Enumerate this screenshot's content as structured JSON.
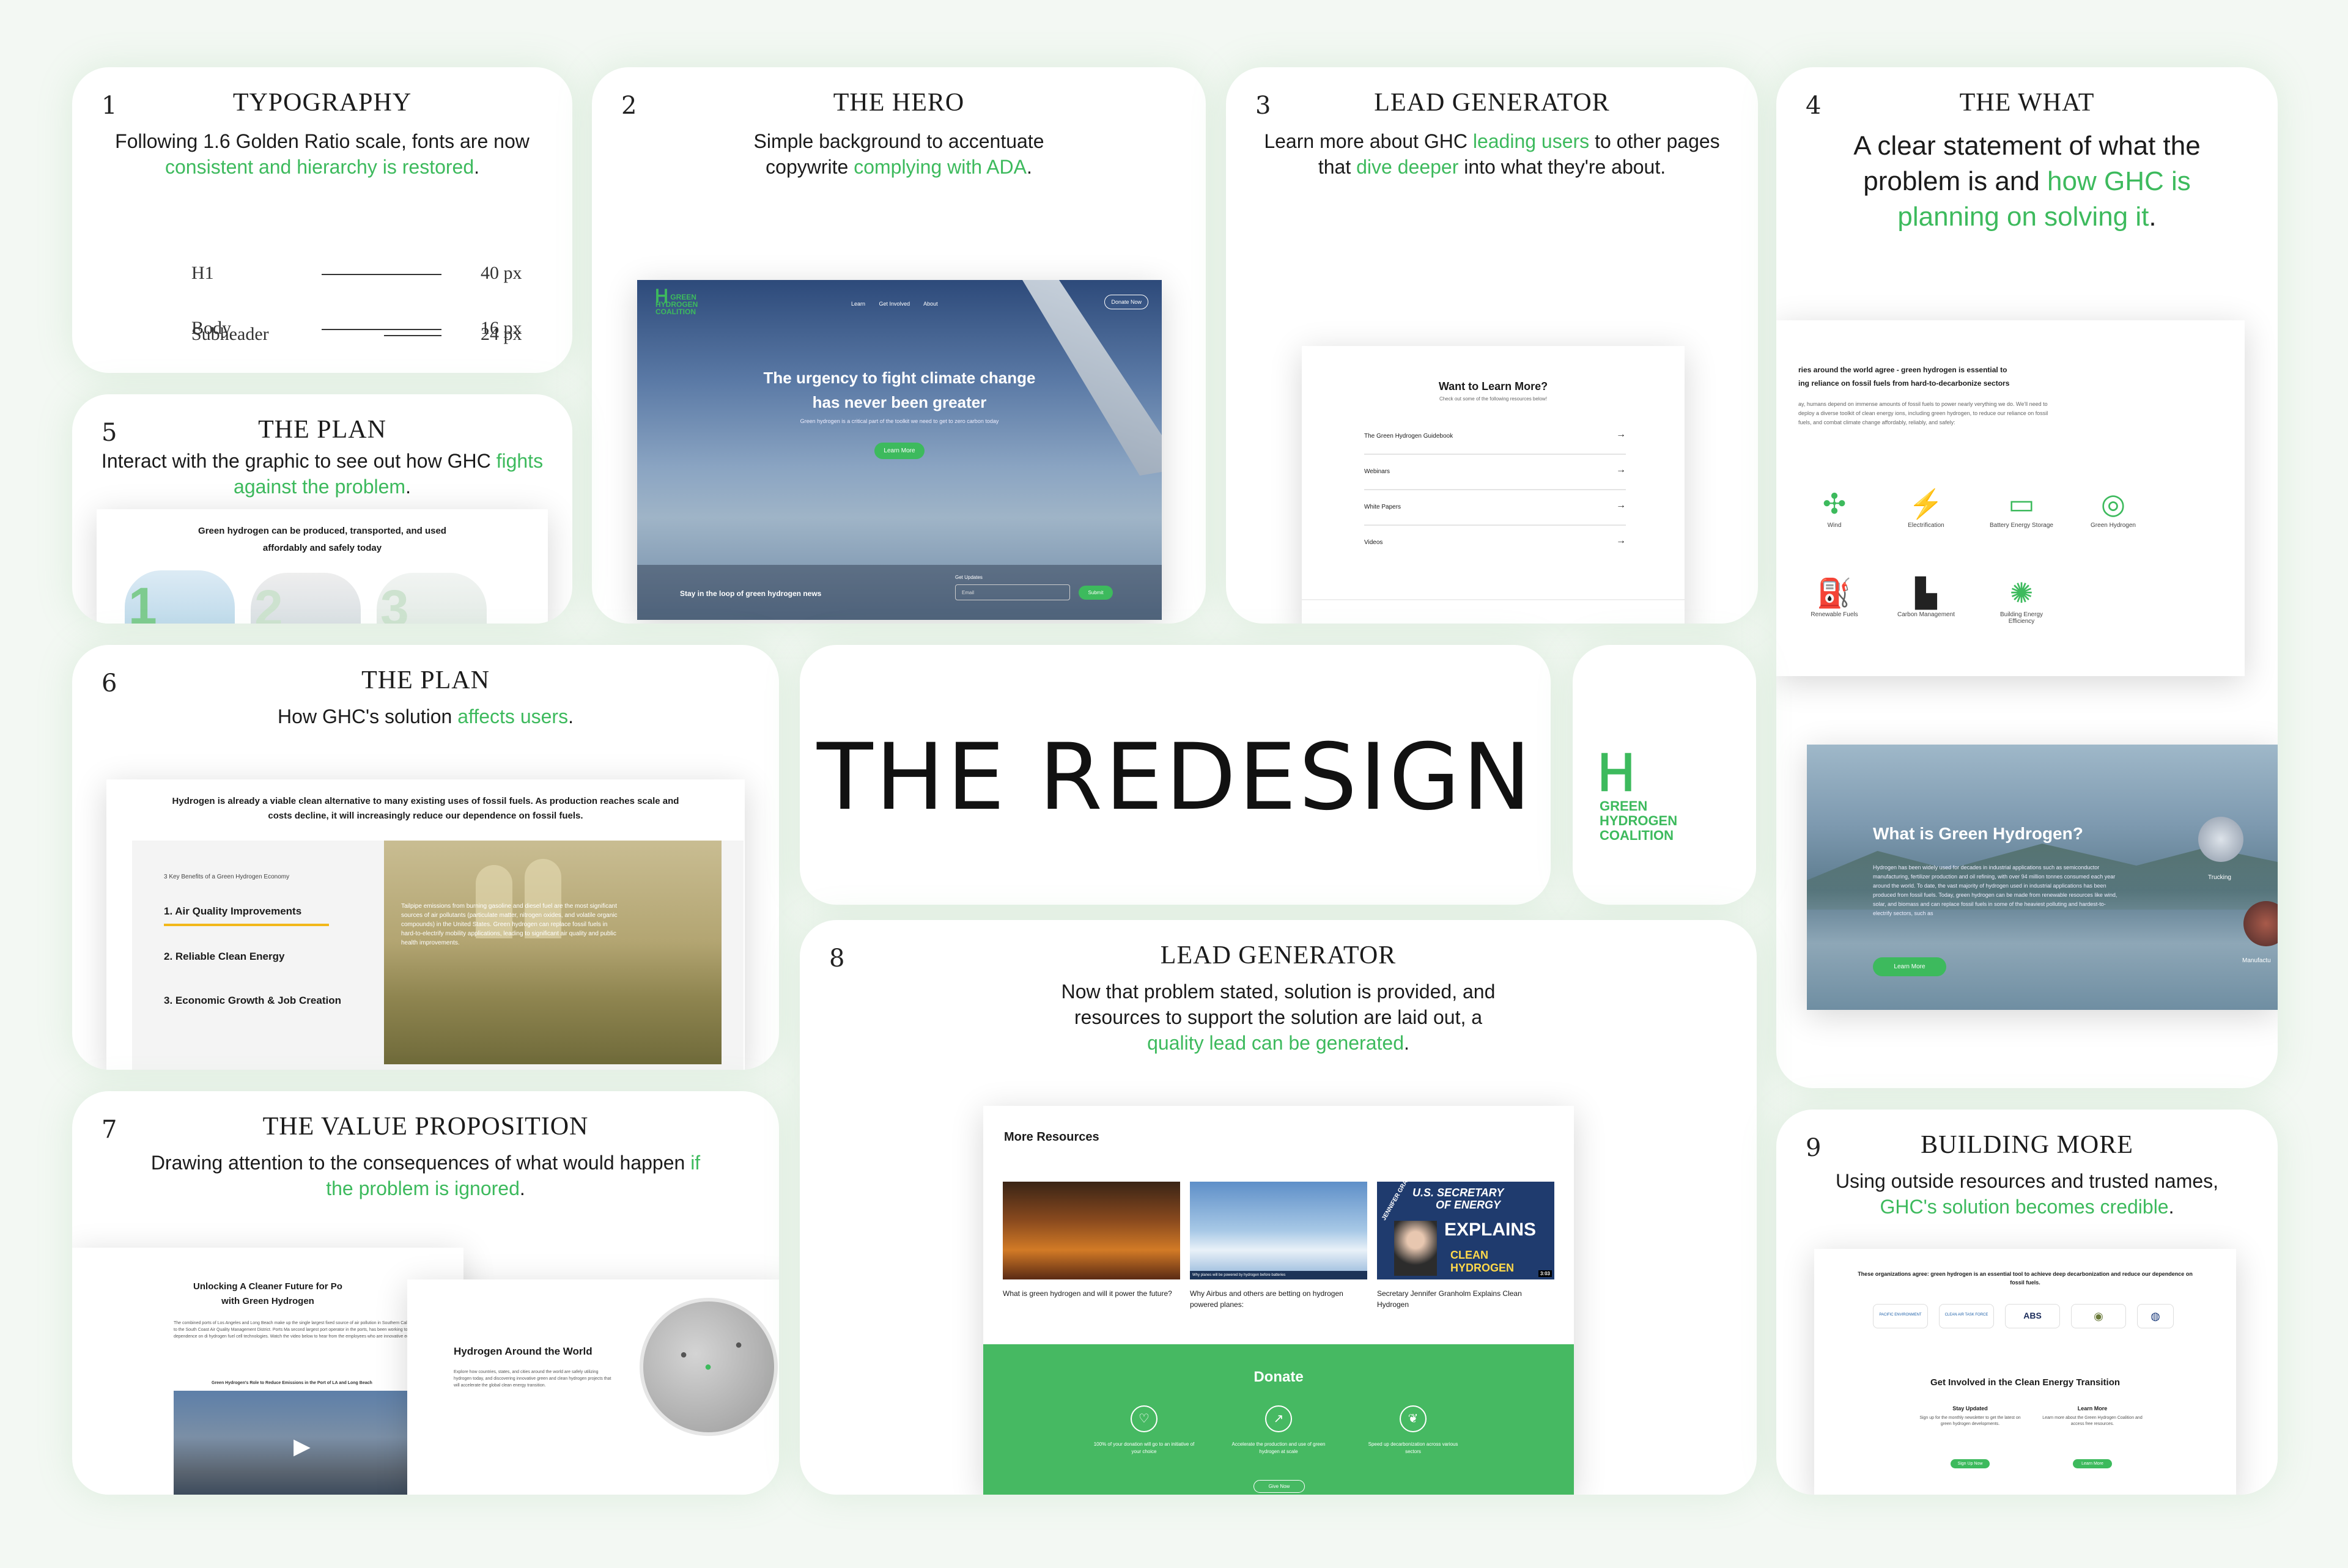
{
  "headline": "THE REDESIGN",
  "brand": {
    "logo_line1": "GREEN",
    "logo_line2": "HYDROGEN",
    "logo_line3": "COALITION",
    "accent": "#3dba5d"
  },
  "cards": {
    "c1": {
      "num": "1",
      "title": "TYPOGRAPHY",
      "desc_a": "Following 1.6 Golden Ratio scale, fonts are now ",
      "desc_hl": "consistent and hierarchy is restored",
      "desc_b": ".",
      "scale": [
        {
          "name": "H1",
          "size": "40 px"
        },
        {
          "name": "Subheader",
          "size": "24 px"
        },
        {
          "name": "Body",
          "size": "16 px"
        }
      ]
    },
    "c2": {
      "num": "2",
      "title": "THE HERO",
      "desc_a": "Simple background to accentuate copywrite ",
      "desc_hl": "complying with ADA",
      "desc_b": ".",
      "mock": {
        "nav": [
          "Learn",
          "Get Involved",
          "About"
        ],
        "donate": "Donate Now",
        "headline_1": "The urgency to fight climate change",
        "headline_2": "has never been greater",
        "sub": "Green hydrogen is a critical part of the toolkit we need to get to zero carbon today",
        "cta": "Learn More",
        "newsletter": "Stay in the loop of green hydrogen news",
        "updates": "Get Updates",
        "email_ph": "Email",
        "submit": "Submit"
      }
    },
    "c3": {
      "num": "3",
      "title": "LEAD GENERATOR",
      "desc_a": "Learn more about GHC ",
      "desc_hl": "leading users",
      "desc_b": " to other pages that ",
      "desc_hl2": "dive deeper",
      "desc_c": " into what they're about.",
      "mock": {
        "heading": "Want to Learn More?",
        "sub": "Check out some of the following resources below!",
        "items": [
          "The Green Hydrogen Guidebook",
          "Webinars",
          "White Papers",
          "Videos"
        ]
      }
    },
    "c4": {
      "num": "4",
      "title": "THE WHAT",
      "desc_a": "A clear statement of what the problem is and ",
      "desc_hl": "how GHC is planning on solving it",
      "desc_b": ".",
      "mock": {
        "heading_1": "ries around the world agree - green hydrogen is essential to",
        "heading_2": "ing reliance on fossil fuels from hard-to-decarbonize sectors",
        "body": "ay, humans depend on immense amounts of fossil fuels to power nearly verything we do. We'll need to deploy a diverse toolkit of clean energy ions, including green hydrogen, to reduce our reliance on fossil fuels, and combat climate change affordably, reliably, and safely:",
        "icons": [
          {
            "label": "Wind",
            "icon": "wind-turbine-icon",
            "glyph": "✣"
          },
          {
            "label": "Electrification",
            "icon": "lightning-icon",
            "glyph": "⚡"
          },
          {
            "label": "Battery Energy Storage",
            "icon": "battery-icon",
            "glyph": "▭"
          },
          {
            "label": "Green Hydrogen",
            "icon": "hydrogen-icon",
            "glyph": "◎"
          },
          {
            "label": "Renewable Fuels",
            "icon": "fuel-icon",
            "glyph": "⛽"
          },
          {
            "label": "Carbon Management",
            "icon": "factory-icon",
            "glyph": "▙"
          },
          {
            "label": "Building Energy Efficiency",
            "icon": "bulb-icon",
            "glyph": "✺"
          }
        ],
        "what_title": "What is Green Hydrogen?",
        "what_body": "Hydrogen has been widely used for decades in industrial applications such as semiconductor manufacturing, fertilizer production and oil refining, with over 94 million tonnes consumed each year around the world. To date, the vast majority of hydrogen used in industrial applications has been produced from fossil fuels. Today, green hydrogen can be made from renewable resources like wind, solar, and biomass and can replace fossil fuels in some of the heaviest polluting and hardest-to-electrify sectors, such as",
        "what_cta": "Learn More",
        "side_1": "Trucking",
        "side_2": "Manufactu"
      }
    },
    "c5": {
      "num": "5",
      "title": "THE PLAN",
      "desc_a": "Interact with the graphic to see out how GHC ",
      "desc_hl": "fights against the problem",
      "desc_b": ".",
      "mock": {
        "heading": "Green hydrogen can be produced, transported, and used affordably and safely today",
        "steps": [
          "1",
          "2",
          "3"
        ]
      }
    },
    "c6": {
      "num": "6",
      "title": "THE PLAN",
      "desc_a": "How GHC's solution ",
      "desc_hl": "affects users",
      "desc_b": ".",
      "mock": {
        "heading": "Hydrogen is already a viable clean alternative to many existing uses of fossil fuels. As production reaches scale and costs decline, it will increasingly reduce our dependence on fossil fuels.",
        "list_title": "3 Key Benefits of a Green Hydrogen Economy",
        "benefits": [
          "1. Air Quality Improvements",
          "2. Reliable Clean Energy",
          "3. Economic Growth & Job Creation"
        ],
        "overlay": "Tailpipe emissions from burning gasoline and diesel fuel are the most significant sources of air pollutants (particulate matter, nitrogen oxides, and volatile organic compounds) in the United States. Green hydrogen can replace fossil fuels in hard-to-electrify mobility applications, leading to significant air quality and public health improvements."
      }
    },
    "c7": {
      "num": "7",
      "title": "THE  VALUE PROPOSITION",
      "desc_a": "Drawing attention to the consequences of what would happen ",
      "desc_hl": "if the problem is ignored",
      "desc_b": ".",
      "mock": {
        "left_title_1": "Unlocking A Cleaner Future for Po",
        "left_title_2": "with Green Hydrogen",
        "left_body": "The combined ports of Los Angeles and Long Beach make up the single largest fixed source of air pollution in Southern California, according to the South Coast Air Quality Management District. Ports Ma second largest port operator in the ports, has been working to reduce their dependence on di hydrogen fuel cell technologies. Watch the video below to hear from the employees who are innovative equipment.",
        "left_caption": "Green Hydrogen's Role to Reduce Emissions in the Port of LA and Long Beach",
        "right_title": "Hydrogen Around the World",
        "right_body": "Explore how countries, states, and cities around the world are safely utilizing hydrogen today, and discovering innovative green and clean hydrogen projects that will accelerate the global clean energy transition."
      }
    },
    "c8": {
      "num": "8",
      "title": "LEAD GENERATOR",
      "desc_a": "Now that problem stated, solution is provided, and resources to support the solution are laid out, a ",
      "desc_hl": "quality lead can be generated",
      "desc_b": ".",
      "mock": {
        "heading": "More Resources",
        "resources": [
          "What is green hydrogen and will it power the future?",
          "Why Airbus and others are betting on hydrogen powered planes:",
          "Secretary Jennifer Granholm Explains Clean Hydrogen"
        ],
        "thumb3_l1": "U.S. SECRETARY",
        "thumb3_l2": "OF ENERGY",
        "thumb3_l3": "EXPLAINS",
        "thumb3_l4": "CLEAN HYDROGEN",
        "thumb3_side": "JENNIFER GRANHOLM",
        "thumb3_time": "3:03",
        "thumb2_banner": "Why planes will be powered by hydrogen before batteries",
        "donate_title": "Donate",
        "donate_items": [
          "100% of your donation will go to an initiative of your choice",
          "Accelerate the production and use of green hydrogen at scale",
          "Speed up decarbonization across various sectors"
        ],
        "donate_btn": "Give Now"
      }
    },
    "c9": {
      "num": "9",
      "title": "BUILDING MORE",
      "desc_a": "Using outside resources and trusted names, ",
      "desc_hl": "GHC's solution becomes credible",
      "desc_b": ".",
      "mock": {
        "heading": "These organizations agree: green hydrogen is an essential tool to achieve deep decarbonization and reduce our dependence on fossil fuels.",
        "logos": [
          "PACIFIC ENVIRONMENT",
          "CLEAN AIR TASK FORCE",
          "ABS",
          "",
          ""
        ],
        "involve": "Get Involved in the Clean Energy Transition",
        "col1_title": "Stay Updated",
        "col1_body": "Sign up for the monthly newsletter to get the latest on green hydrogen developments.",
        "col1_btn": "Sign Up Now",
        "col2_title": "Learn More",
        "col2_body": "Learn more about the Green Hydrogen Coalition and access free resources.",
        "col2_btn": "Learn More"
      }
    }
  }
}
